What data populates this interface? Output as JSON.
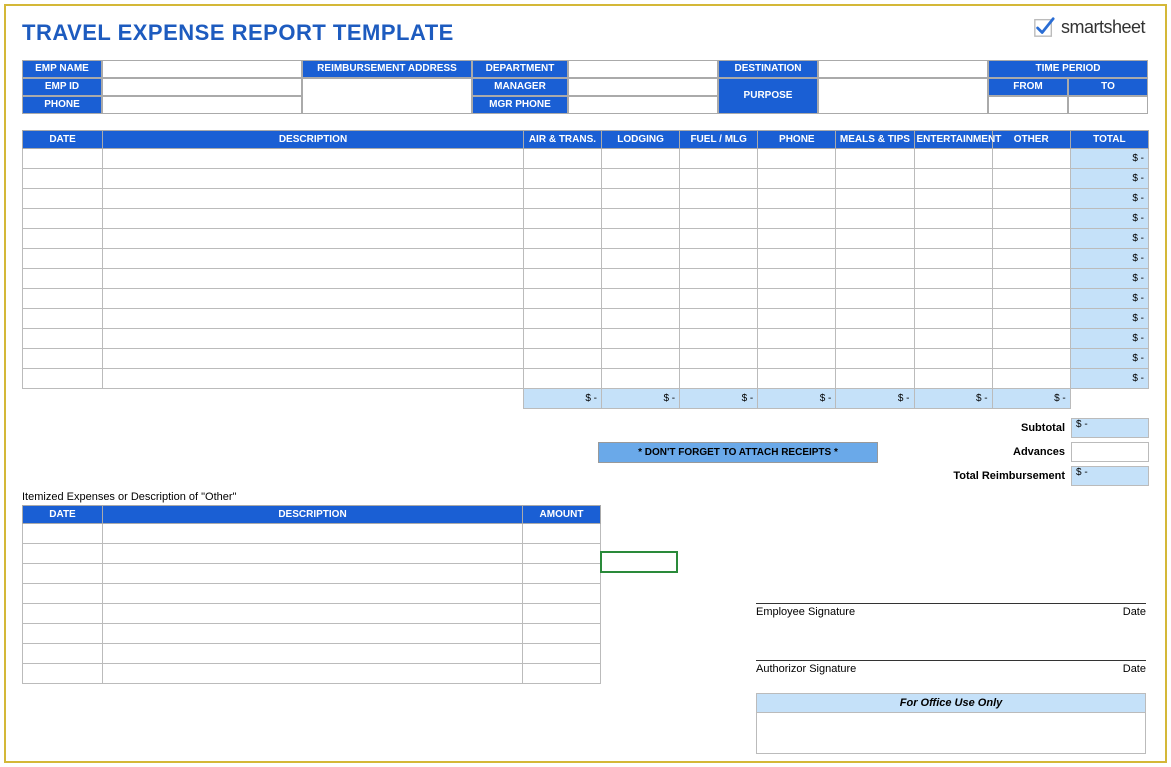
{
  "title": "TRAVEL EXPENSE REPORT TEMPLATE",
  "brand": {
    "name": "smartsheet"
  },
  "info": {
    "emp_name_label": "EMP NAME",
    "emp_name": "",
    "reimb_addr_label": "REIMBURSEMENT ADDRESS",
    "reimb_addr": "",
    "dept_label": "DEPARTMENT",
    "dept": "",
    "dest_label": "DESTINATION",
    "dest": "",
    "time_period_label": "TIME PERIOD",
    "emp_id_label": "EMP ID",
    "emp_id": "",
    "manager_label": "MANAGER",
    "manager": "",
    "purpose_label": "PURPOSE",
    "purpose": "",
    "from_label": "FROM",
    "from": "",
    "to_label": "TO",
    "to": "",
    "phone_label": "PHONE",
    "phone": "",
    "mgr_phone_label": "MGR PHONE",
    "mgr_phone": ""
  },
  "columns": {
    "date": "DATE",
    "desc": "DESCRIPTION",
    "air": "AIR & TRANS.",
    "lodging": "LODGING",
    "fuel": "FUEL / MLG",
    "phone": "PHONE",
    "meals": "MEALS & TIPS",
    "ent": "ENTERTAINMENT",
    "other": "OTHER",
    "total": "TOTAL"
  },
  "row_total_display": "$            -",
  "subtotal_cells": [
    "$            -",
    "$            -",
    "$            -",
    "$            -",
    "$            -",
    "$            -",
    "$            -"
  ],
  "row_count": 12,
  "summary": {
    "subtotal_label": "Subtotal",
    "subtotal_value": "$            -",
    "advances_label": "Advances",
    "advances_value": "",
    "total_reimb_label": "Total Reimbursement",
    "total_reimb_value": "$            -"
  },
  "receipts_note": "* DON'T FORGET TO ATTACH RECEIPTS *",
  "itemized_title": "Itemized Expenses or Description of \"Other\"",
  "item_columns": {
    "date": "DATE",
    "desc": "DESCRIPTION",
    "amount": "AMOUNT"
  },
  "item_row_count": 8,
  "signatures": {
    "emp_label": "Employee Signature",
    "auth_label": "Authorizor Signature",
    "date_label": "Date"
  },
  "office_use": "For Office Use Only"
}
